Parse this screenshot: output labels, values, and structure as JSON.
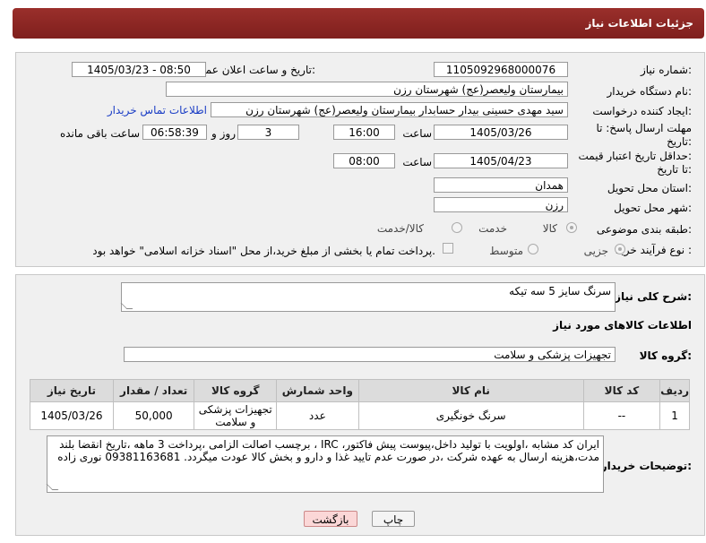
{
  "header": {
    "title": "جزئیات اطلاعات نیاز"
  },
  "form": {
    "need_number_label": "شماره نیاز:",
    "need_number": "1105092968000076",
    "announce_label": "تاریخ و ساعت اعلان عمومی:",
    "announce_value": "1405/03/23 - 08:50",
    "buyer_org_label": "نام دستگاه خریدار:",
    "buyer_org": "بیمارستان ولیعصر(عج) شهرستان رزن",
    "creator_label": "ایجاد کننده درخواست:",
    "creator": "سید مهدی حسینی بیدار حسابدار بیمارستان ولیعصر(عج) شهرستان رزن",
    "contact_link": "اطلاعات تماس خریدار",
    "reply_deadline_label_1": "مهلت ارسال پاسخ: تا",
    "reply_deadline_label_2": "تاریخ:",
    "reply_date": "1405/03/26",
    "time_label": "ساعت",
    "reply_time": "16:00",
    "days_value": "3",
    "days_label": "روز و",
    "remaining_time": "06:58:39",
    "remaining_label": "ساعت باقی مانده",
    "price_valid_label_1": "حداقل تاریخ اعتبار قیمت:",
    "price_valid_label_2": "تا تاریخ:",
    "price_valid_date": "1405/04/23",
    "price_valid_time": "08:00",
    "province_label": "استان محل تحویل:",
    "province": "همدان",
    "city_label": "شهر محل تحویل:",
    "city": "رزن",
    "category_label": "طبقه بندی موضوعی:",
    "category_options": [
      "کالا",
      "خدمت",
      "کالا/خدمت"
    ],
    "process_label": "نوع فرآیند خرید :",
    "process_options": [
      "جزیی",
      "متوسط"
    ],
    "payment_note": "پرداخت تمام یا بخشی از مبلغ خرید،از محل \"اسناد خزانه اسلامی\" خواهد بود."
  },
  "summary": {
    "description_label": "شرح کلی نیاز:",
    "description": "سرنگ سایز 5 سه تیکه",
    "goods_info_title": "اطلاعات کالاهای مورد نیاز",
    "group_label": "گروه کالا:",
    "group_value": "تجهیزات پزشکی و سلامت"
  },
  "table": {
    "headers": [
      "ردیف",
      "کد کالا",
      "نام کالا",
      "واحد شمارش",
      "گروه کالا",
      "تعداد / مقدار",
      "تاریخ نیاز"
    ],
    "rows": [
      [
        "1",
        "--",
        "سرنگ خونگیری",
        "عدد",
        "تجهیزات پزشکی و سلامت",
        "50,000",
        "1405/03/26"
      ]
    ]
  },
  "notes": {
    "label": "توضیحات خریدار:",
    "text": "ایران کد مشابه ،اولویت با تولید داخل،پیوست پیش فاکتور، IRC ، برچسب اصالت الزامی ،پرداخت 3 ماهه ،تاریخ انقضا بلند مدت،هزینه ارسال به عهده شرکت ،در صورت عدم تایید غذا و دارو و بخش کالا عودت میگردد. 09381163681 نوری زاده"
  },
  "buttons": {
    "print": "چاپ",
    "back": "بازگشت"
  }
}
